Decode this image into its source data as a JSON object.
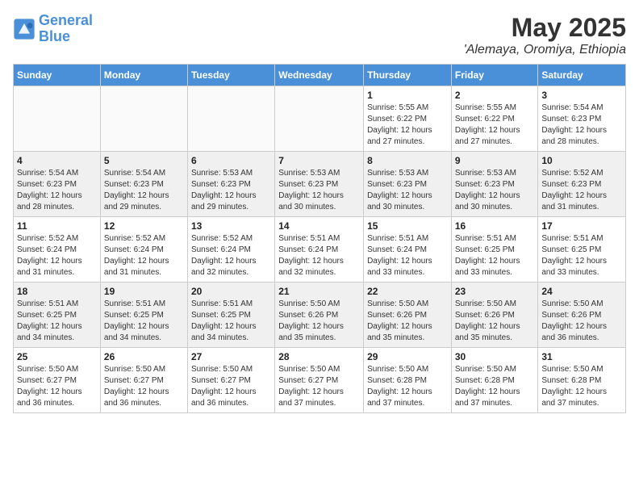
{
  "header": {
    "logo_line1": "General",
    "logo_line2": "Blue",
    "month_year": "May 2025",
    "location": "'Alemaya, Oromiya, Ethiopia"
  },
  "days_of_week": [
    "Sunday",
    "Monday",
    "Tuesday",
    "Wednesday",
    "Thursday",
    "Friday",
    "Saturday"
  ],
  "weeks": [
    [
      {
        "day": "",
        "info": ""
      },
      {
        "day": "",
        "info": ""
      },
      {
        "day": "",
        "info": ""
      },
      {
        "day": "",
        "info": ""
      },
      {
        "day": "1",
        "info": "Sunrise: 5:55 AM\nSunset: 6:22 PM\nDaylight: 12 hours\nand 27 minutes."
      },
      {
        "day": "2",
        "info": "Sunrise: 5:55 AM\nSunset: 6:22 PM\nDaylight: 12 hours\nand 27 minutes."
      },
      {
        "day": "3",
        "info": "Sunrise: 5:54 AM\nSunset: 6:23 PM\nDaylight: 12 hours\nand 28 minutes."
      }
    ],
    [
      {
        "day": "4",
        "info": "Sunrise: 5:54 AM\nSunset: 6:23 PM\nDaylight: 12 hours\nand 28 minutes."
      },
      {
        "day": "5",
        "info": "Sunrise: 5:54 AM\nSunset: 6:23 PM\nDaylight: 12 hours\nand 29 minutes."
      },
      {
        "day": "6",
        "info": "Sunrise: 5:53 AM\nSunset: 6:23 PM\nDaylight: 12 hours\nand 29 minutes."
      },
      {
        "day": "7",
        "info": "Sunrise: 5:53 AM\nSunset: 6:23 PM\nDaylight: 12 hours\nand 30 minutes."
      },
      {
        "day": "8",
        "info": "Sunrise: 5:53 AM\nSunset: 6:23 PM\nDaylight: 12 hours\nand 30 minutes."
      },
      {
        "day": "9",
        "info": "Sunrise: 5:53 AM\nSunset: 6:23 PM\nDaylight: 12 hours\nand 30 minutes."
      },
      {
        "day": "10",
        "info": "Sunrise: 5:52 AM\nSunset: 6:23 PM\nDaylight: 12 hours\nand 31 minutes."
      }
    ],
    [
      {
        "day": "11",
        "info": "Sunrise: 5:52 AM\nSunset: 6:24 PM\nDaylight: 12 hours\nand 31 minutes."
      },
      {
        "day": "12",
        "info": "Sunrise: 5:52 AM\nSunset: 6:24 PM\nDaylight: 12 hours\nand 31 minutes."
      },
      {
        "day": "13",
        "info": "Sunrise: 5:52 AM\nSunset: 6:24 PM\nDaylight: 12 hours\nand 32 minutes."
      },
      {
        "day": "14",
        "info": "Sunrise: 5:51 AM\nSunset: 6:24 PM\nDaylight: 12 hours\nand 32 minutes."
      },
      {
        "day": "15",
        "info": "Sunrise: 5:51 AM\nSunset: 6:24 PM\nDaylight: 12 hours\nand 33 minutes."
      },
      {
        "day": "16",
        "info": "Sunrise: 5:51 AM\nSunset: 6:25 PM\nDaylight: 12 hours\nand 33 minutes."
      },
      {
        "day": "17",
        "info": "Sunrise: 5:51 AM\nSunset: 6:25 PM\nDaylight: 12 hours\nand 33 minutes."
      }
    ],
    [
      {
        "day": "18",
        "info": "Sunrise: 5:51 AM\nSunset: 6:25 PM\nDaylight: 12 hours\nand 34 minutes."
      },
      {
        "day": "19",
        "info": "Sunrise: 5:51 AM\nSunset: 6:25 PM\nDaylight: 12 hours\nand 34 minutes."
      },
      {
        "day": "20",
        "info": "Sunrise: 5:51 AM\nSunset: 6:25 PM\nDaylight: 12 hours\nand 34 minutes."
      },
      {
        "day": "21",
        "info": "Sunrise: 5:50 AM\nSunset: 6:26 PM\nDaylight: 12 hours\nand 35 minutes."
      },
      {
        "day": "22",
        "info": "Sunrise: 5:50 AM\nSunset: 6:26 PM\nDaylight: 12 hours\nand 35 minutes."
      },
      {
        "day": "23",
        "info": "Sunrise: 5:50 AM\nSunset: 6:26 PM\nDaylight: 12 hours\nand 35 minutes."
      },
      {
        "day": "24",
        "info": "Sunrise: 5:50 AM\nSunset: 6:26 PM\nDaylight: 12 hours\nand 36 minutes."
      }
    ],
    [
      {
        "day": "25",
        "info": "Sunrise: 5:50 AM\nSunset: 6:27 PM\nDaylight: 12 hours\nand 36 minutes."
      },
      {
        "day": "26",
        "info": "Sunrise: 5:50 AM\nSunset: 6:27 PM\nDaylight: 12 hours\nand 36 minutes."
      },
      {
        "day": "27",
        "info": "Sunrise: 5:50 AM\nSunset: 6:27 PM\nDaylight: 12 hours\nand 36 minutes."
      },
      {
        "day": "28",
        "info": "Sunrise: 5:50 AM\nSunset: 6:27 PM\nDaylight: 12 hours\nand 37 minutes."
      },
      {
        "day": "29",
        "info": "Sunrise: 5:50 AM\nSunset: 6:28 PM\nDaylight: 12 hours\nand 37 minutes."
      },
      {
        "day": "30",
        "info": "Sunrise: 5:50 AM\nSunset: 6:28 PM\nDaylight: 12 hours\nand 37 minutes."
      },
      {
        "day": "31",
        "info": "Sunrise: 5:50 AM\nSunset: 6:28 PM\nDaylight: 12 hours\nand 37 minutes."
      }
    ]
  ]
}
